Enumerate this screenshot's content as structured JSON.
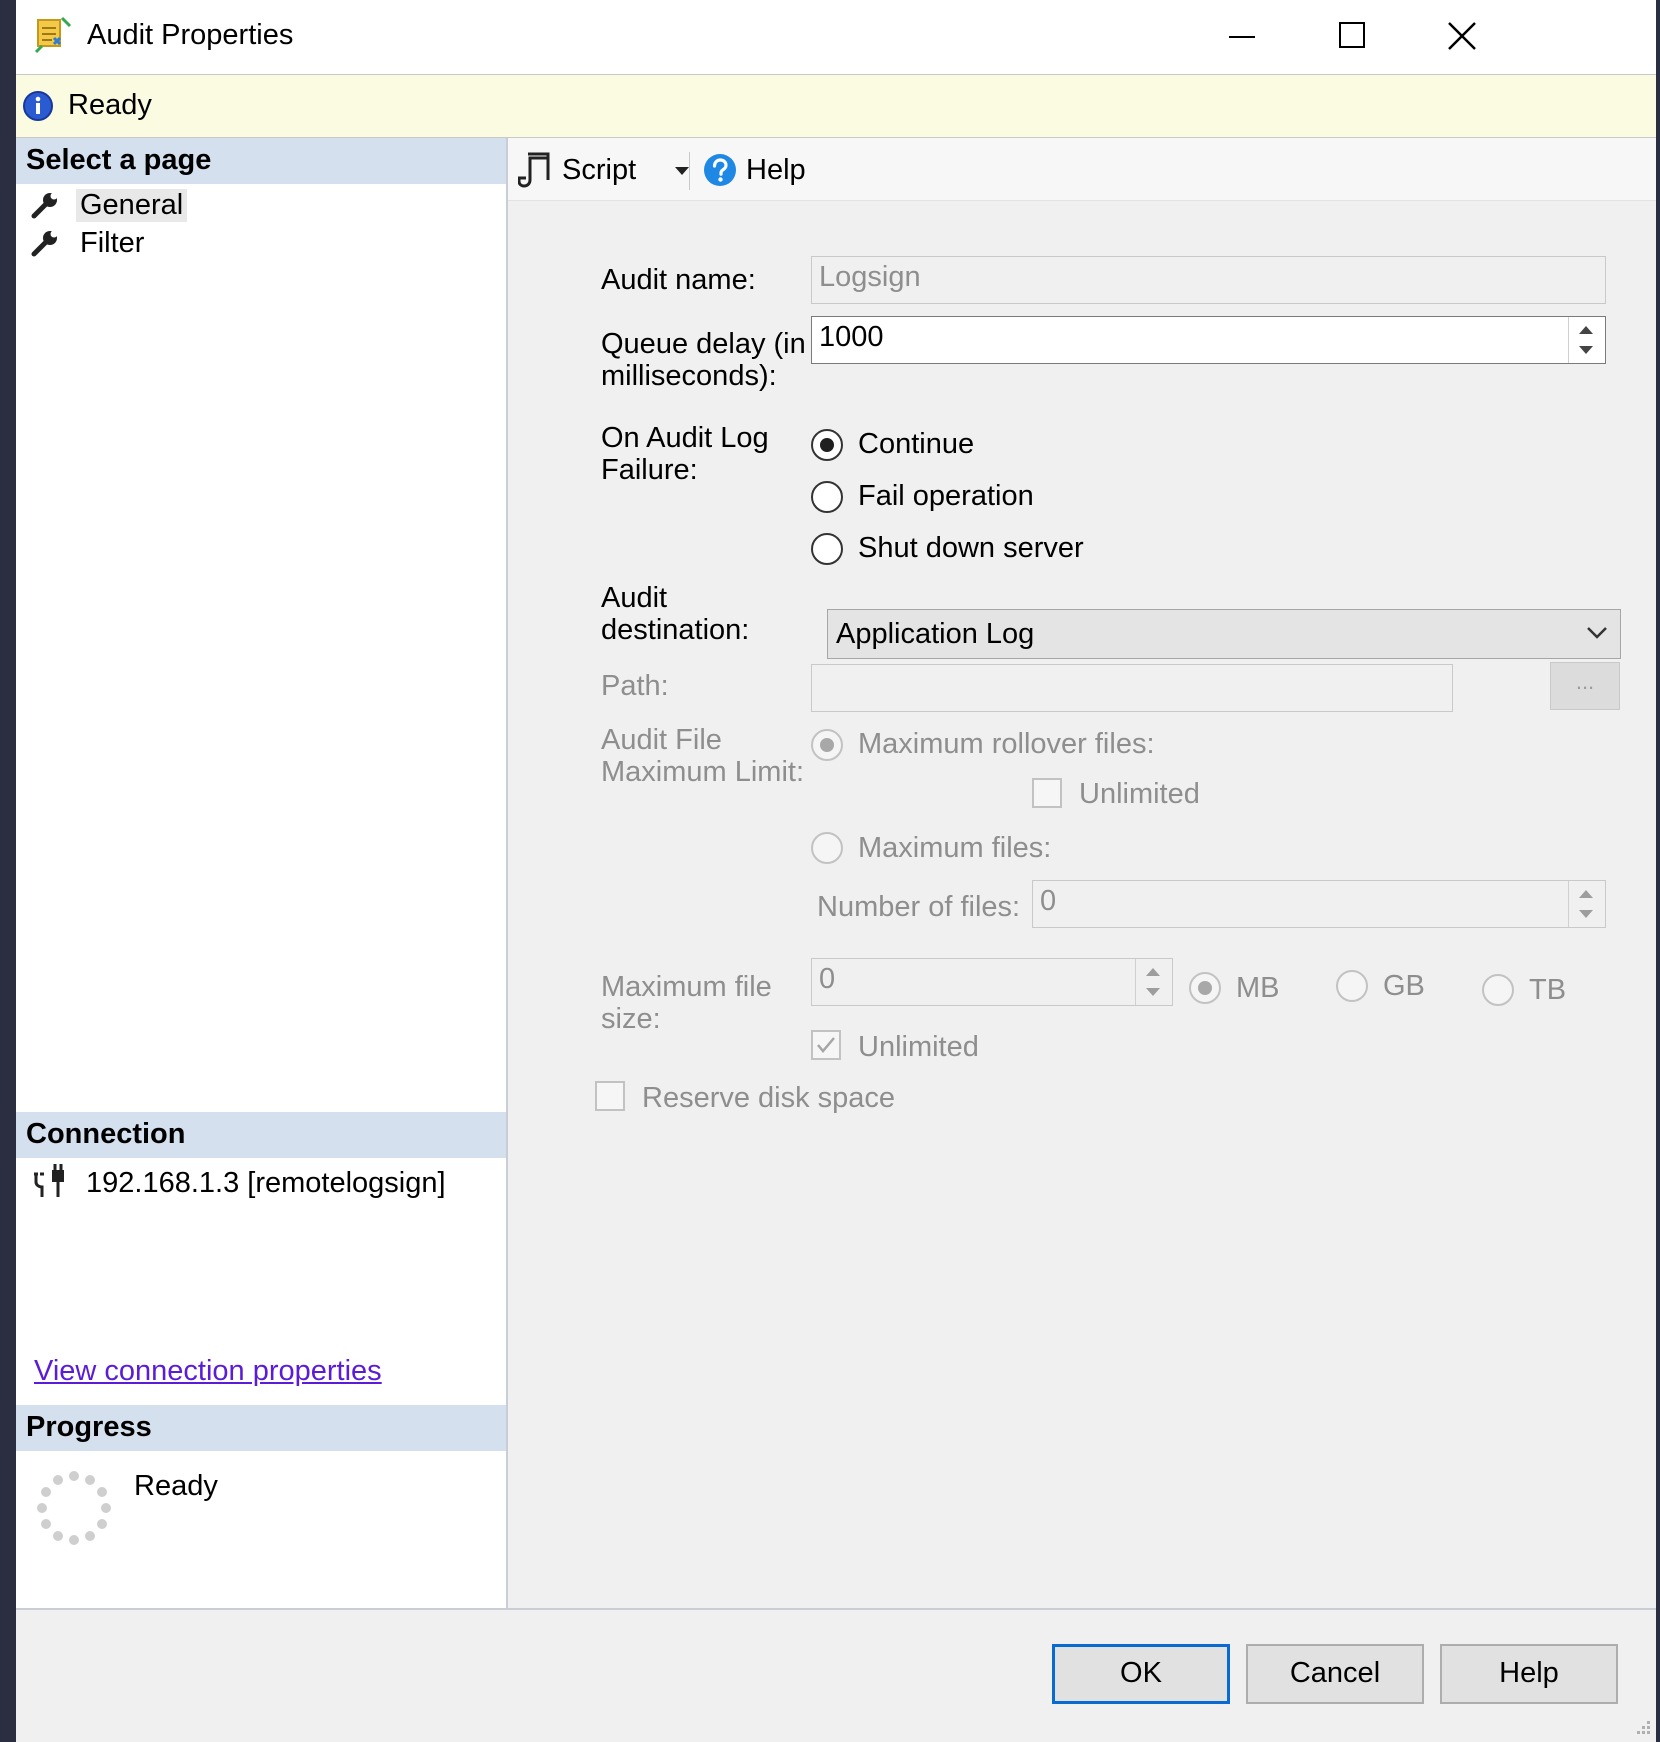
{
  "window": {
    "title": "Audit Properties",
    "status": "Ready"
  },
  "left_pane": {
    "select_page_header": "Select a page",
    "pages": [
      {
        "label": "General",
        "selected": true
      },
      {
        "label": "Filter",
        "selected": false
      }
    ],
    "connection_header": "Connection",
    "connection": "192.168.1.3 [remotelogsign]",
    "view_connection_link": "View connection properties",
    "progress_header": "Progress",
    "progress_status": "Ready"
  },
  "toolbar": {
    "script_label": "Script",
    "help_label": "Help"
  },
  "form": {
    "audit_name_label": "Audit name:",
    "audit_name_value": "Logsign",
    "queue_delay_label_1": "Queue delay (in",
    "queue_delay_label_2": "milliseconds):",
    "queue_delay_value": "1000",
    "on_failure_label_1": "On Audit Log",
    "on_failure_label_2": "Failure:",
    "on_failure_options": [
      "Continue",
      "Fail operation",
      "Shut down server"
    ],
    "on_failure_selected": "Continue",
    "destination_label_1": "Audit",
    "destination_label_2": "destination:",
    "destination_value": "Application Log",
    "path_label": "Path:",
    "path_value": "",
    "browse_label": "...",
    "max_limit_label_1": "Audit File",
    "max_limit_label_2": "Maximum Limit:",
    "max_rollover_label": "Maximum rollover files:",
    "unlimited_rollover_label": "Unlimited",
    "max_files_label": "Maximum files:",
    "number_of_files_label": "Number of files:",
    "number_of_files_value": "0",
    "max_file_size_label_1": "Maximum file",
    "max_file_size_label_2": "size:",
    "max_file_size_value": "0",
    "size_units": [
      "MB",
      "GB",
      "TB"
    ],
    "size_unit_selected": "MB",
    "unlimited_size_label": "Unlimited",
    "unlimited_size_checked": true,
    "reserve_disk_label": "Reserve disk space",
    "reserve_disk_checked": false
  },
  "buttons": {
    "ok": "OK",
    "cancel": "Cancel",
    "help": "Help"
  },
  "colors": {
    "status_bar_bg": "#fbfbe2",
    "section_header_bg": "#d5e0ef",
    "link": "#5a1cd6",
    "default_button_border": "#0a6ad4"
  }
}
